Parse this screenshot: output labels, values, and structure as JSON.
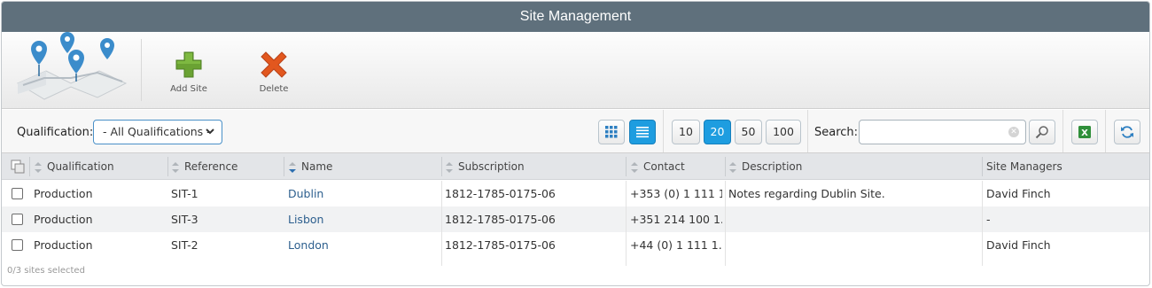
{
  "window": {
    "title": "Site Management"
  },
  "toolbar": {
    "logo_icon": "map-pins-icon",
    "add_label": "Add Site",
    "add_icon": "plus-icon",
    "delete_label": "Delete",
    "delete_icon": "x-icon"
  },
  "filter": {
    "qualification_label": "Qualification:",
    "qualification_value": "- All Qualifications -",
    "view_grid_icon": "grid-view-icon",
    "view_list_icon": "list-view-icon",
    "page_sizes": [
      "10",
      "20",
      "50",
      "100"
    ],
    "page_size_selected": "20",
    "search_label": "Search:",
    "search_value": "",
    "search_icon": "magnifier-icon",
    "export_icon": "excel-icon",
    "refresh_icon": "refresh-icon"
  },
  "table": {
    "columns": [
      "Qualification",
      "Reference",
      "Name",
      "Subscription",
      "Contact",
      "Description",
      "Site Managers"
    ],
    "sorted_column": "Name",
    "rows": [
      {
        "qualification": "Production",
        "reference": "SIT-1",
        "name": "Dublin",
        "subscription": "1812-1785-0175-06",
        "contact": "+353 (0) 1 111 1...",
        "description": "Notes regarding Dublin Site.",
        "managers": "David Finch"
      },
      {
        "qualification": "Production",
        "reference": "SIT-3",
        "name": "Lisbon",
        "subscription": "1812-1785-0175-06",
        "contact": "+351 214 100 1...",
        "description": "",
        "managers": "-"
      },
      {
        "qualification": "Production",
        "reference": "SIT-2",
        "name": "London",
        "subscription": "1812-1785-0175-06",
        "contact": "+44 (0) 1 111 1...",
        "description": "",
        "managers": "David Finch"
      }
    ]
  },
  "footer": {
    "selection_status": "0/3 sites selected"
  },
  "colors": {
    "titlebar": "#5f707c",
    "accent": "#1e9de0",
    "link": "#2d5f8e",
    "add": "#6aa233",
    "delete": "#e2571e"
  }
}
